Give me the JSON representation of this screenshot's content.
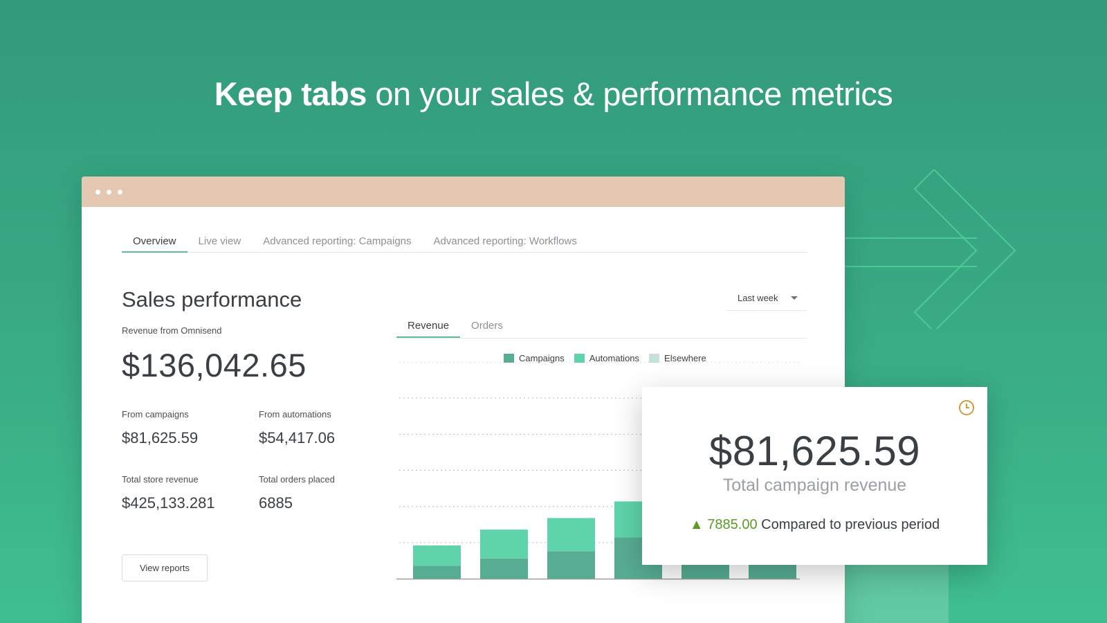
{
  "headline": {
    "bold": "Keep tabs",
    "rest": " on your sales & performance metrics"
  },
  "tabs": [
    {
      "label": "Overview",
      "active": true
    },
    {
      "label": "Live view",
      "active": false
    },
    {
      "label": "Advanced reporting: Campaigns",
      "active": false
    },
    {
      "label": "Advanced reporting: Workflows",
      "active": false
    }
  ],
  "sales": {
    "title": "Sales performance",
    "revenue_label": "Revenue from Omnisend",
    "revenue_value": "$136,042.65",
    "stats": [
      {
        "label": "From campaigns",
        "value": "$81,625.59"
      },
      {
        "label": "From automations",
        "value": "$54,417.06"
      },
      {
        "label": "Total store revenue",
        "value": "$425,133.281"
      },
      {
        "label": "Total orders placed",
        "value": "6885"
      }
    ],
    "view_reports": "View reports"
  },
  "period_select": "Last week",
  "chart_tabs": [
    {
      "label": "Revenue",
      "active": true
    },
    {
      "label": "Orders",
      "active": false
    }
  ],
  "colors": {
    "campaigns": "#57ad92",
    "automations": "#5fd4aa",
    "elsewhere": "#c6e0dc",
    "accent": "#5fb8a2",
    "bg": "#36a07d"
  },
  "chart_data": {
    "type": "bar",
    "stacked": true,
    "categories": [
      "",
      "",
      "",
      "",
      "",
      ""
    ],
    "series": [
      {
        "name": "Campaigns",
        "values": [
          18,
          28,
          38,
          57,
          45,
          45
        ]
      },
      {
        "name": "Automations",
        "values": [
          28,
          40,
          46,
          50,
          0,
          0
        ]
      },
      {
        "name": "Elsewhere",
        "values": [
          0,
          0,
          0,
          0,
          0,
          0
        ]
      }
    ],
    "ylim": [
      0,
      300
    ],
    "grid": true,
    "legend": "top"
  },
  "popup": {
    "value": "$81,625.59",
    "label": "Total campaign revenue",
    "delta": "7885.00",
    "delta_text": "Compared to previous period",
    "icon": "clock-icon"
  }
}
